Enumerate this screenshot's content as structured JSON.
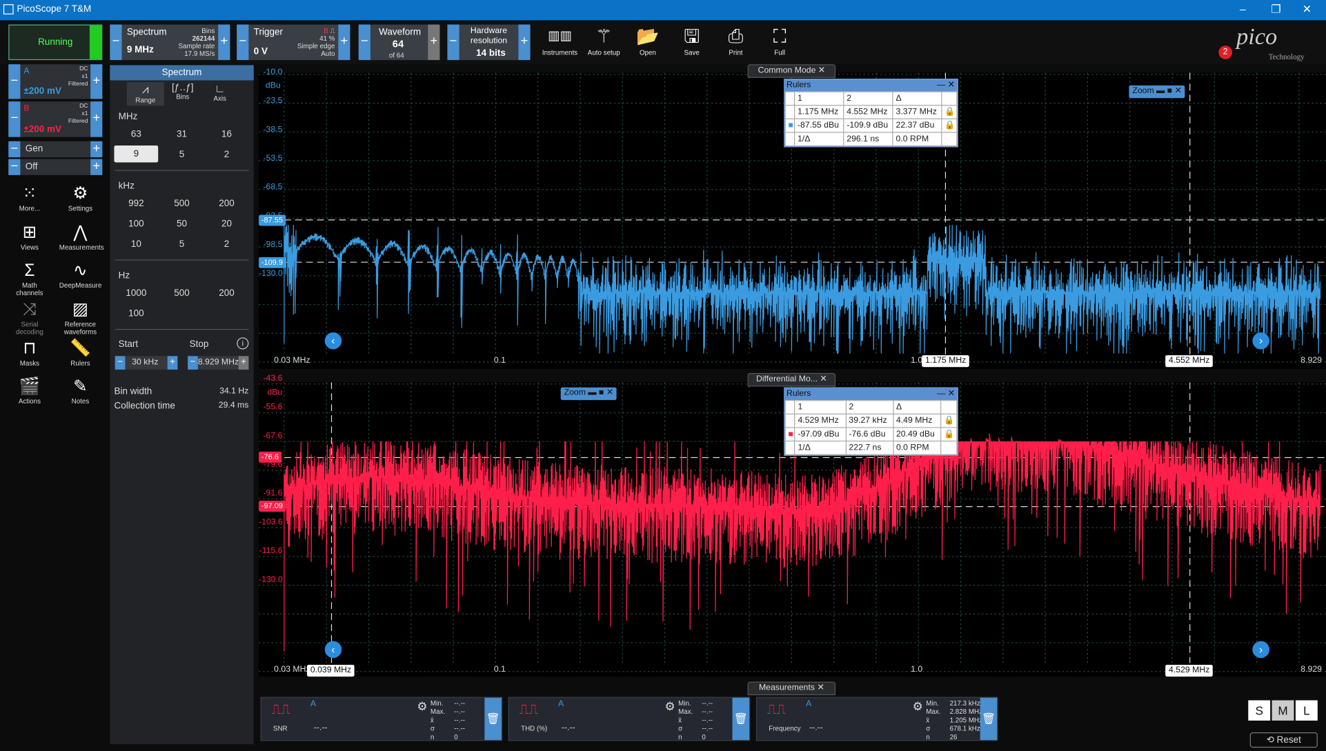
{
  "window": {
    "title": "PicoScope 7 T&M"
  },
  "toolbar": {
    "run_label": "Running",
    "spectrum": {
      "label": "Spectrum",
      "value": "9 MHz",
      "bins_label": "Bins",
      "bins": "262144",
      "rate_label": "Sample rate",
      "rate": "17.9 MS/s"
    },
    "trigger": {
      "label": "Trigger",
      "value": "0 V",
      "ch": "B",
      "pct": "41 %",
      "type": "Simple edge",
      "mode": "Auto"
    },
    "waveform": {
      "label": "Waveform",
      "count": "64",
      "of": "of 64"
    },
    "hardware": {
      "label": "Hardware resolution",
      "value": "14 bits"
    },
    "buttons": [
      {
        "name": "instruments",
        "label": "Instruments"
      },
      {
        "name": "auto-setup",
        "label": "Auto setup"
      },
      {
        "name": "open",
        "label": "Open"
      },
      {
        "name": "save",
        "label": "Save"
      },
      {
        "name": "print",
        "label": "Print"
      },
      {
        "name": "full",
        "label": "Full"
      }
    ],
    "notification_count": "2",
    "logo": "pico",
    "logo_sub": "Technology"
  },
  "channels": {
    "a": {
      "name": "A",
      "range": "±200 mV",
      "coupling": "DC",
      "probe": "x1",
      "filter": "Filtered"
    },
    "b": {
      "name": "B",
      "range": "±200 mV",
      "coupling": "DC",
      "probe": "x1",
      "filter": "Filtered"
    },
    "gen": "Gen",
    "off": "Off"
  },
  "leftnav": [
    "More...",
    "Settings",
    "Views",
    "Measurements",
    "Math channels",
    "DeepMeasure",
    "Serial decoding",
    "Reference waveforms",
    "Masks",
    "Rulers",
    "Actions",
    "Notes"
  ],
  "spectrum_panel": {
    "header": "Spectrum",
    "tabs": [
      "Range",
      "Bins",
      "Axis"
    ],
    "mhz_label": "MHz",
    "mhz": [
      "63",
      "31",
      "16",
      "9",
      "5",
      "2"
    ],
    "khz_label": "kHz",
    "khz": [
      "992",
      "500",
      "200",
      "100",
      "50",
      "20",
      "10",
      "5",
      "2"
    ],
    "hz_label": "Hz",
    "hz": [
      "1000",
      "500",
      "200",
      "100"
    ],
    "start_label": "Start",
    "stop_label": "Stop",
    "start": "30 kHz",
    "stop": "8.929 MHz",
    "binwidth_label": "Bin width",
    "binwidth": "34.1 Hz",
    "coltime_label": "Collection time",
    "coltime": "29.4 ms"
  },
  "plot1": {
    "title": "Common Mode",
    "unit": "dBu",
    "yticks": [
      "-10.0",
      "-23.5",
      "-38.5",
      "-53.5",
      "-68.5",
      "-83.5",
      "-98.5",
      "-130.0"
    ],
    "xticks": [
      "0.03 MHz",
      "0.1",
      "1.0",
      "8.929"
    ],
    "ruler_tags": {
      "y1": "-87.55",
      "y2": "-109.9",
      "x1": "1.175 MHz",
      "x2": "4.552 MHz"
    },
    "rulers": {
      "title": "Rulers",
      "h1": "1",
      "h2": "2",
      "h3": "Δ",
      "r1": [
        "1.175 MHz",
        "4.552 MHz",
        "3.377 MHz"
      ],
      "r2": [
        "-87.55 dBu",
        "-109.9 dBu",
        "22.37 dBu"
      ],
      "r3": [
        "1/Δ",
        "296.1 ns",
        "0.0 RPM"
      ]
    },
    "zoom": "Zoom"
  },
  "plot2": {
    "title": "Differential Mo...",
    "unit": "dBu",
    "yticks": [
      "-43.6",
      "-55.6",
      "-67.6",
      "-79.6",
      "-91.6",
      "-103.6",
      "-115.6",
      "-130.0"
    ],
    "xticks": [
      "0.03 MHz",
      "0.1",
      "1.0",
      "8.929"
    ],
    "ruler_tags": {
      "y1": "-76.6",
      "y2": "-97.09",
      "x1": "0.039 MHz",
      "x2": "4.529 MHz"
    },
    "rulers": {
      "title": "Rulers",
      "h1": "1",
      "h2": "2",
      "h3": "Δ",
      "r1": [
        "4.529 MHz",
        "39.27 kHz",
        "4.49 MHz"
      ],
      "r2": [
        "-97.09 dBu",
        "-76.6 dBu",
        "20.49 dBu"
      ],
      "r3": [
        "1/Δ",
        "222.7 ns",
        "0.0 RPM"
      ]
    },
    "zoom": "Zoom"
  },
  "measurements": {
    "title": "Measurements",
    "stat_labels": [
      "Min.",
      "Max.",
      "x̄",
      "σ",
      "n"
    ],
    "items": [
      {
        "name": "SNR",
        "ch": "A",
        "value": "--.--",
        "stats": [
          "--.--",
          "--.--",
          "--.--",
          "--.--",
          "0"
        ]
      },
      {
        "name": "THD (%)",
        "ch": "A",
        "value": "--.--",
        "stats": [
          "--.--",
          "--.--",
          "--.--",
          "--.--",
          "0"
        ]
      },
      {
        "name": "Frequency",
        "ch": "A",
        "value": "--.--",
        "stats": [
          "217.3 kHz",
          "2.828 MHz",
          "1.205 MHz",
          "678.1 kHz",
          "26"
        ]
      }
    ],
    "sizes": [
      "S",
      "M",
      "L"
    ],
    "reset": "Reset"
  },
  "colors": {
    "accent": "#4a8fd0",
    "chA": "#3a9be0",
    "chB": "#ff1f4a",
    "running": "#22cc22"
  }
}
